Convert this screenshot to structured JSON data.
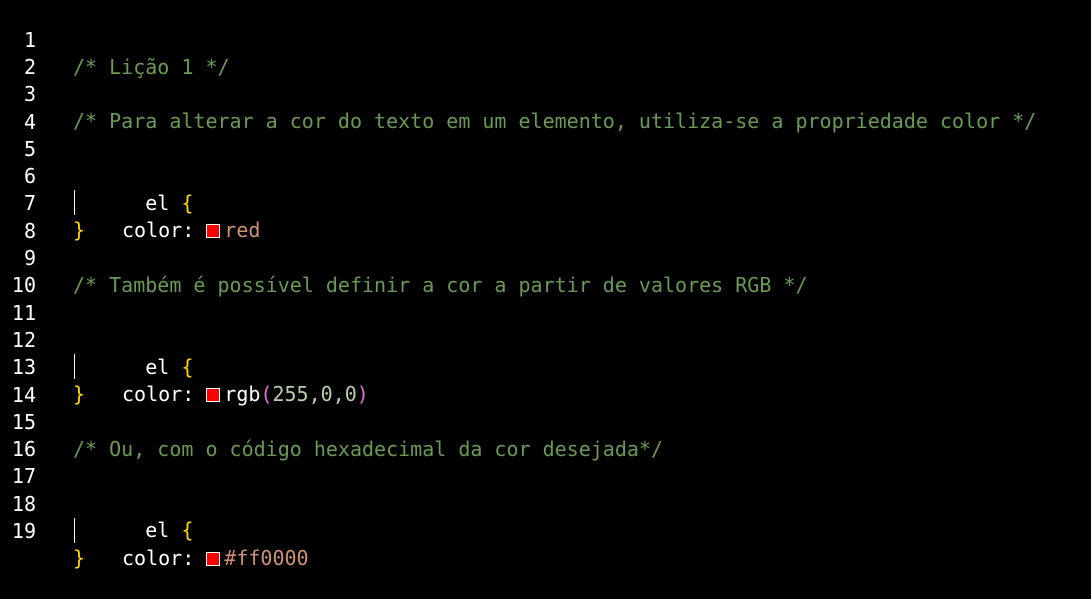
{
  "editor": {
    "lines": [
      {
        "n": "1"
      },
      {
        "n": "2"
      },
      {
        "n": "3"
      },
      {
        "n": "4"
      },
      {
        "n": "5"
      },
      {
        "n": "6"
      },
      {
        "n": "7"
      },
      {
        "n": "8"
      },
      {
        "n": "9"
      },
      {
        "n": "10"
      },
      {
        "n": "11"
      },
      {
        "n": "12"
      },
      {
        "n": "13"
      },
      {
        "n": "14"
      },
      {
        "n": "15"
      },
      {
        "n": "16"
      },
      {
        "n": "17"
      },
      {
        "n": "18"
      },
      {
        "n": "19"
      }
    ],
    "comment_1": "/* Lição 1 */",
    "comment_3": "/* Para alterar a cor do texto em um elemento, utiliza-se a propriedade color */",
    "comment_9": "/* Também é possível definir a cor a partir de valores RGB */",
    "comment_15": "/* Ou, com o código hexadecimal da cor desejada*/",
    "selector": "el",
    "open_brace": "{",
    "close_brace": "}",
    "property": "color:",
    "value_red": "red",
    "value_rgb_fn": "rgb",
    "value_rgb_open": "(",
    "value_rgb_args": "255,0,0",
    "value_rgb_close": ")",
    "value_hex": "#ff0000",
    "swatch_color": "#ff0000",
    "colors": {
      "background": "#000000",
      "comment": "#6a9955",
      "brace": "#ffd700",
      "paren": "#da70d6",
      "string": "#ce9178"
    }
  }
}
